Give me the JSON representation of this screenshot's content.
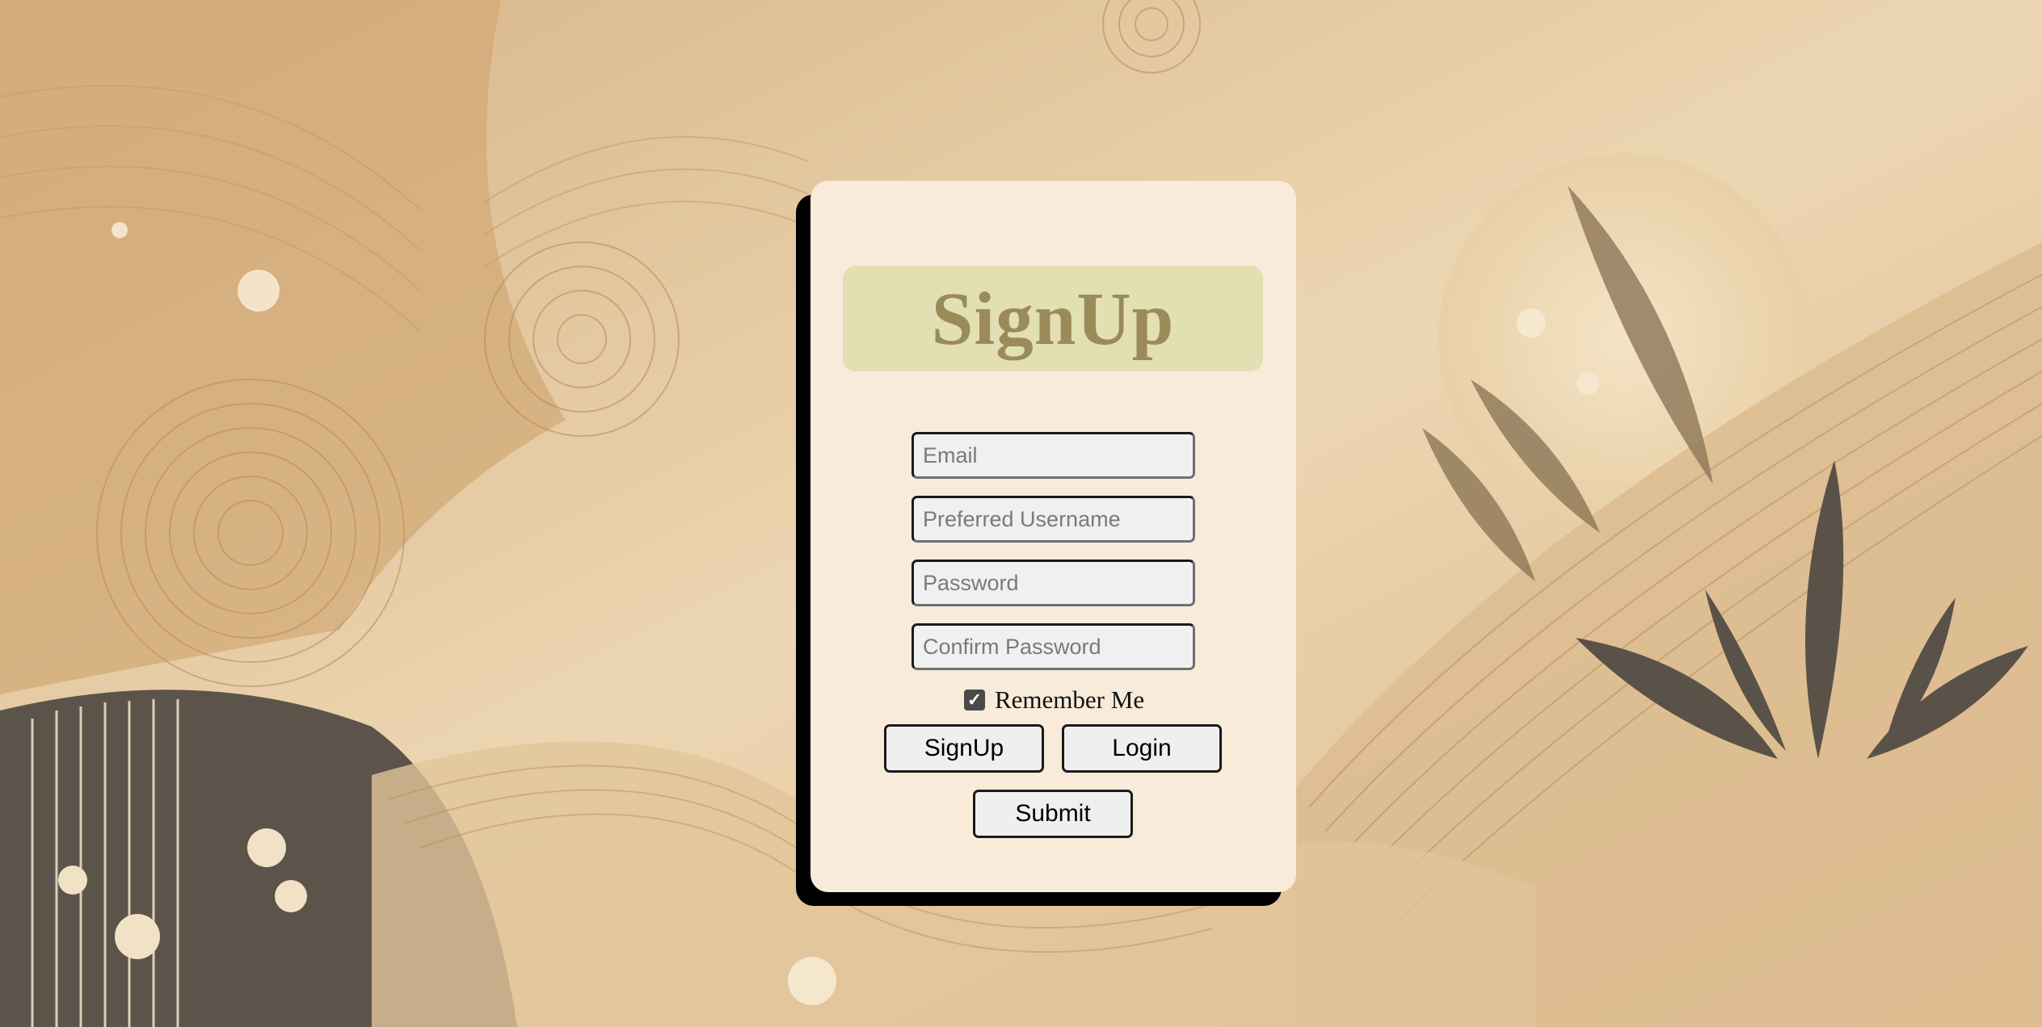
{
  "signup_form": {
    "title": "SignUp",
    "fields": {
      "email_placeholder": "Email",
      "username_placeholder": "Preferred Username",
      "password_placeholder": "Password",
      "confirm_password_placeholder": "Confirm Password"
    },
    "remember_me": {
      "label": "Remember Me",
      "checked": true
    },
    "buttons": {
      "signup": "SignUp",
      "login": "Login",
      "submit": "Submit"
    }
  },
  "colors": {
    "card_background": "#f8ebd9",
    "title_background": "#e2dfb3",
    "title_text": "#9b8b5a",
    "card_shadow": "#000000"
  }
}
